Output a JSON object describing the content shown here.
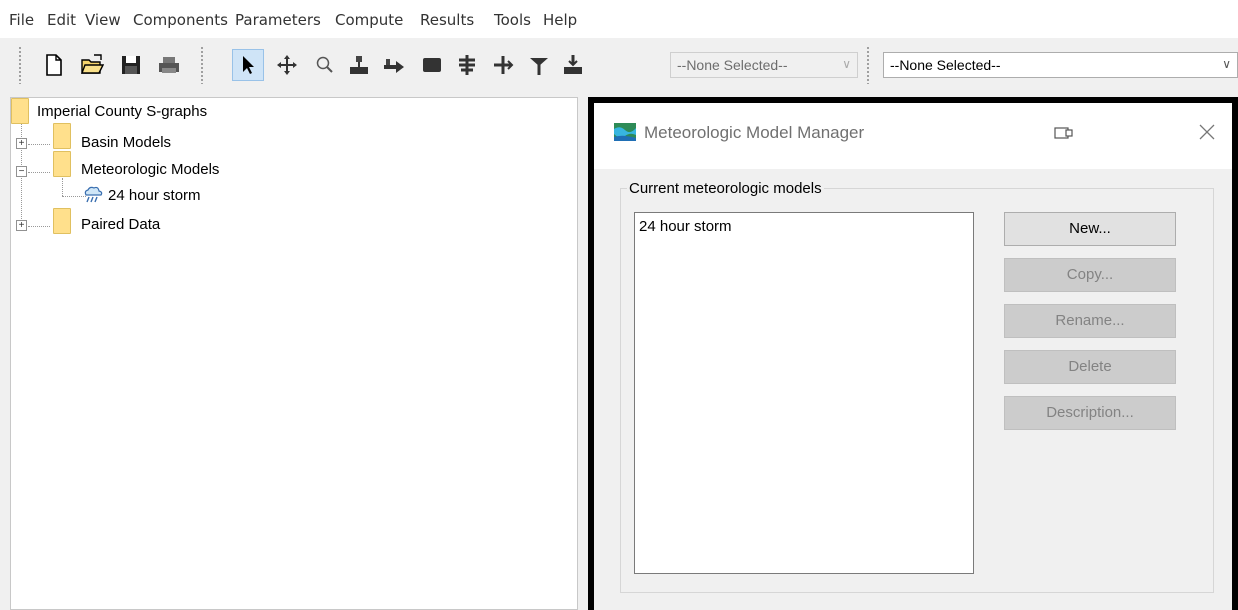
{
  "menu": [
    "File",
    "Edit",
    "View",
    "Components",
    "Parameters",
    "Compute",
    "Results",
    "Tools",
    "Help"
  ],
  "toolbar": {
    "combo1": "--None Selected--",
    "combo2": "--None Selected--"
  },
  "tree": {
    "root": "Imperial County S-graphs",
    "basin": "Basin Models",
    "met": "Meteorologic Models",
    "met_child": "24 hour storm",
    "paired": "Paired Data"
  },
  "dialog": {
    "title": "Meteorologic Model Manager",
    "group_label": "Current meteorologic models",
    "items": [
      "24 hour storm"
    ],
    "buttons": {
      "new": "New...",
      "copy": "Copy...",
      "rename": "Rename...",
      "delete": "Delete",
      "description": "Description..."
    }
  },
  "colors": {
    "accent": "#cfe4f7",
    "folder": "#ffe08c"
  }
}
